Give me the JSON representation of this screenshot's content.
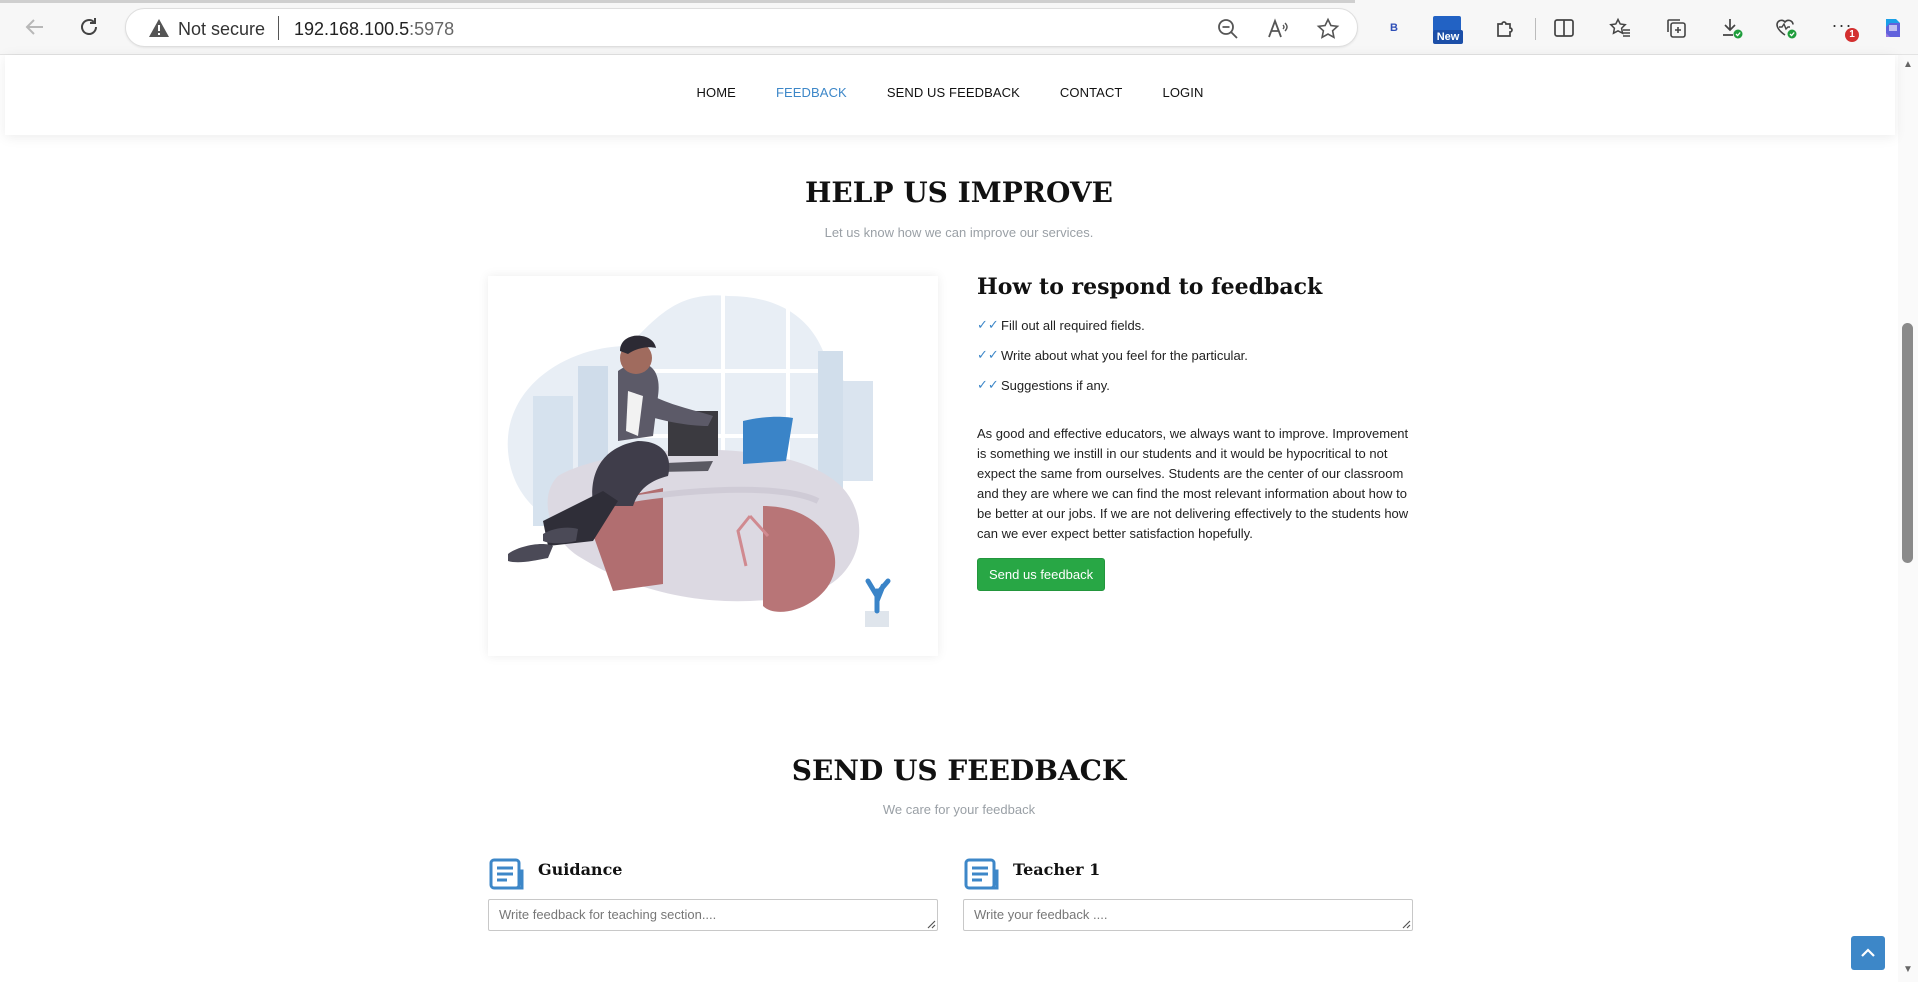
{
  "browser": {
    "not_secure_label": "Not secure",
    "url_host": "192.168.100.5",
    "url_port": ":5978",
    "new_badge": "New",
    "notification_count": "1",
    "profile_letter": "B"
  },
  "nav": {
    "items": [
      {
        "label": "HOME",
        "active": false
      },
      {
        "label": "FEEDBACK",
        "active": true
      },
      {
        "label": "SEND US FEEDBACK",
        "active": false
      },
      {
        "label": "CONTACT",
        "active": false
      },
      {
        "label": "LOGIN",
        "active": false
      }
    ]
  },
  "improve": {
    "title": "HELP US IMPROVE",
    "subtitle": "Let us know how we can improve our services.",
    "how_title": "How to respond to feedback",
    "steps": [
      "Fill out all required fields.",
      "Write about what you feel for the particular.",
      "Suggestions if any."
    ],
    "paragraph": "As good and effective educators, we always want to improve. Improvement is something we instill in our students and it would be hypocritical to not expect the same from ourselves. Students are the center of our classroom and they are where we can find the most relevant information about how to be better at our jobs. If we are not delivering effectively to the students how can we ever expect better satisfaction hopefully.",
    "button_label": "Send us feedback"
  },
  "send": {
    "title": "SEND US FEEDBACK",
    "subtitle": "We care for your feedback",
    "forms": [
      {
        "heading": "Guidance",
        "placeholder": "Write feedback for teaching section...."
      },
      {
        "heading": "Teacher 1",
        "placeholder": "Write your feedback ...."
      }
    ]
  },
  "colors": {
    "accent": "#3d87c8",
    "button_green": "#28a745"
  }
}
